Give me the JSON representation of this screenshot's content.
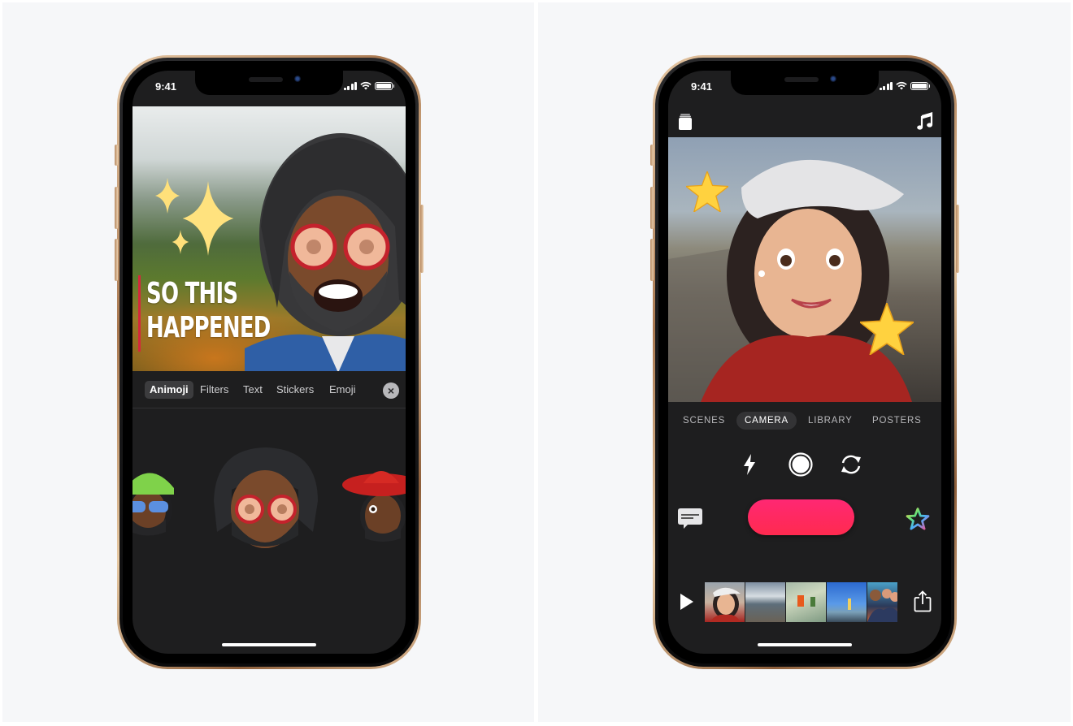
{
  "left_phone": {
    "status_bar": {
      "time": "9:41"
    },
    "video_title": {
      "line1": "SO THIS",
      "line2": "HAPPENED"
    },
    "effects_tabs": [
      {
        "label": "Animoji",
        "active": true
      },
      {
        "label": "Filters",
        "active": false
      },
      {
        "label": "Text",
        "active": false
      },
      {
        "label": "Stickers",
        "active": false
      },
      {
        "label": "Emoji",
        "active": false
      }
    ],
    "close_icon": "×",
    "animoji_options": [
      "memoji-green-beanie",
      "memoji-dreadlocks-red-glasses",
      "memoji-sombrero"
    ],
    "colors": {
      "title_accent": "#d6283b",
      "active_tab_bg": "#3c3c3e"
    }
  },
  "right_phone": {
    "status_bar": {
      "time": "9:41"
    },
    "top_bar": {
      "left_icon": "projects-icon",
      "right_icon": "music-note-icon"
    },
    "mode_tabs": [
      {
        "label": "SCENES",
        "active": false
      },
      {
        "label": "CAMERA",
        "active": true
      },
      {
        "label": "LIBRARY",
        "active": false
      },
      {
        "label": "POSTERS",
        "active": false
      }
    ],
    "camera_controls": [
      "flash-icon",
      "shutter-icon",
      "flip-camera-icon"
    ],
    "record_row": {
      "left_icon": "live-titles-icon",
      "right_icon": "effects-star-icon"
    },
    "timeline": {
      "play_icon": "play-icon",
      "share_icon": "share-icon",
      "clips": [
        "memoji-girl-beret",
        "beach-waves",
        "green-net-climb",
        "ocean-jump",
        "group-selfie"
      ]
    },
    "colors": {
      "record_button": "#ff2a5f",
      "active_tab_bg": "#333335"
    }
  }
}
